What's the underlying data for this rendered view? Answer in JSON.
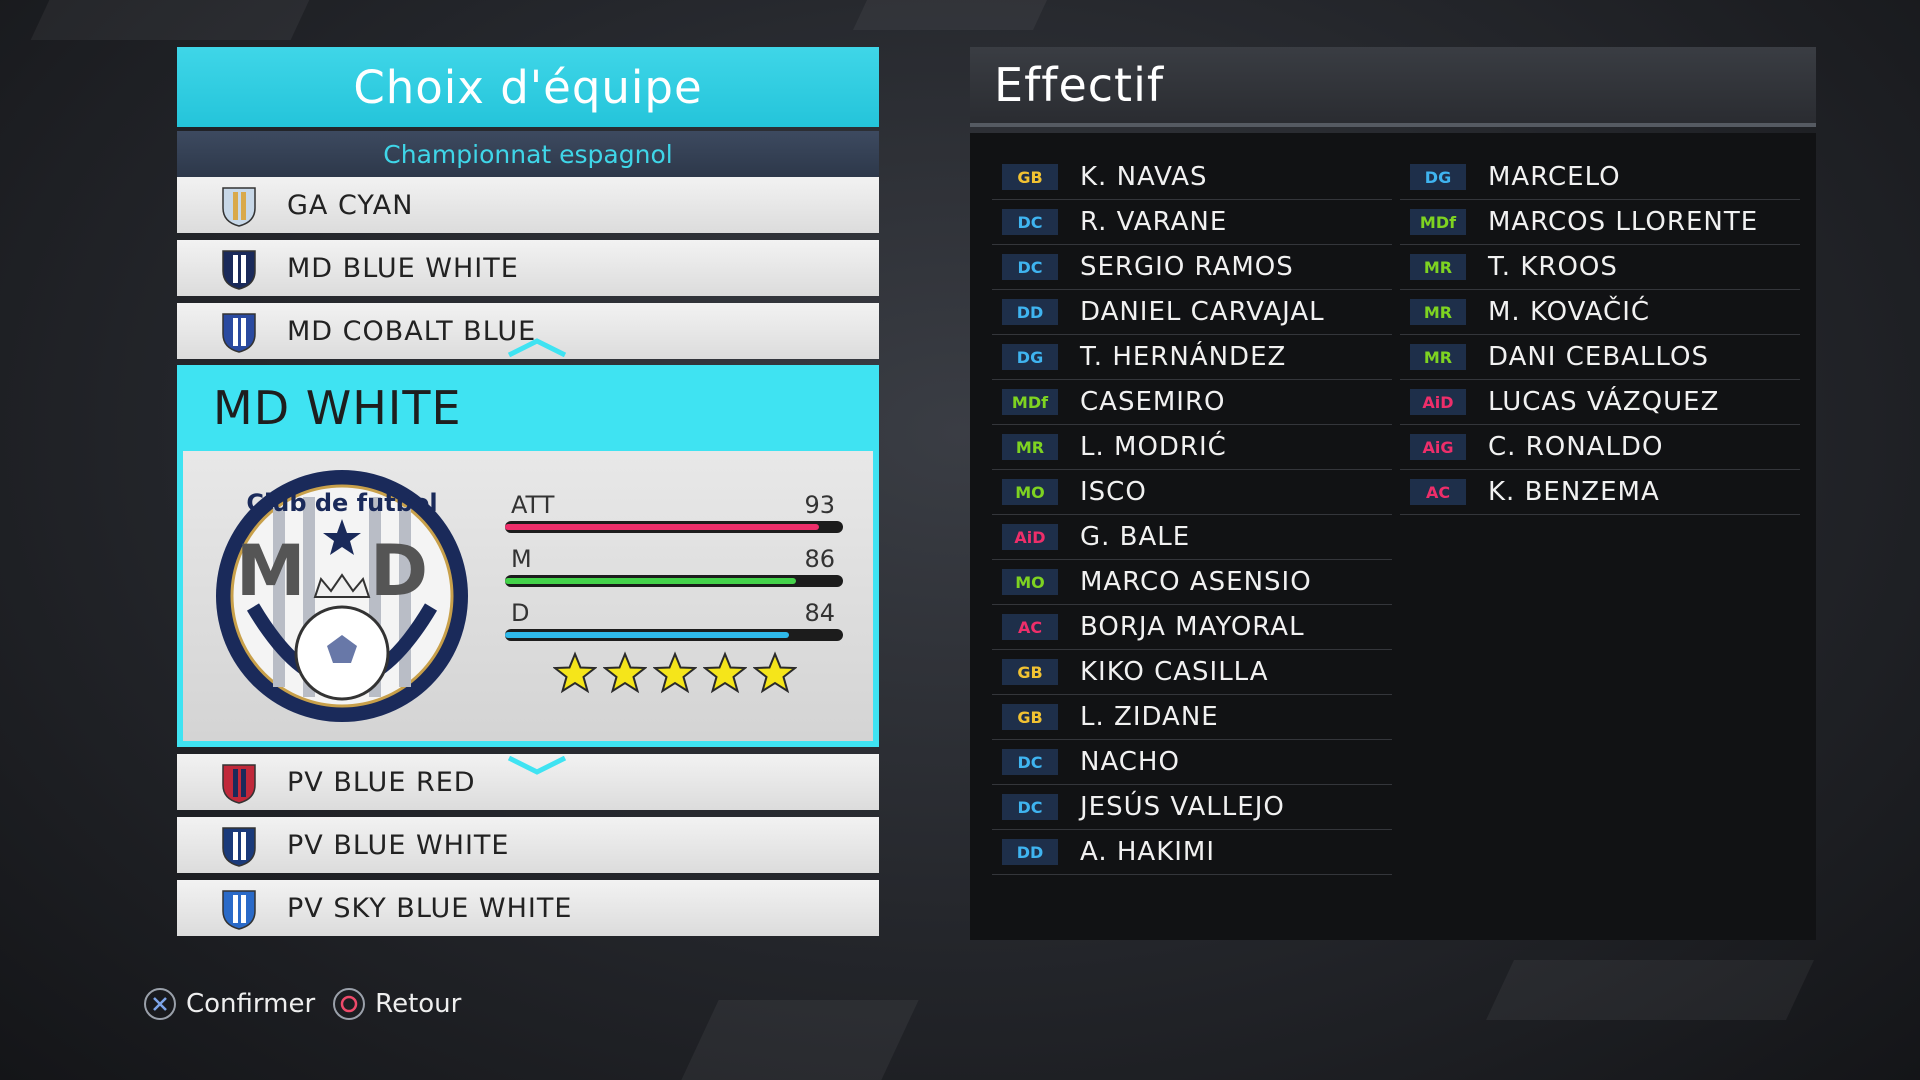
{
  "team_select": {
    "title": "Choix d'équipe",
    "league": "Championnat espagnol",
    "teams_above": [
      {
        "name": "GA CYAN"
      },
      {
        "name": "MD BLUE WHITE"
      },
      {
        "name": "MD COBALT BLUE"
      }
    ],
    "selected": {
      "name": "MD WHITE",
      "emblem_text": "Club de futbol",
      "emblem_letters": "M D",
      "stats": [
        {
          "label": "ATT",
          "value": "93",
          "level": 0.93,
          "color": "#ee2e6a"
        },
        {
          "label": "M",
          "value": "86",
          "level": 0.86,
          "color": "#44d24a"
        },
        {
          "label": "D",
          "value": "84",
          "level": 0.84,
          "color": "#2fb9ea"
        }
      ],
      "stars": 5
    },
    "teams_below": [
      {
        "name": "PV BLUE RED"
      },
      {
        "name": "PV BLUE WHITE"
      },
      {
        "name": "PV SKY BLUE WHITE"
      }
    ]
  },
  "hints": {
    "confirm": "Confirmer",
    "back": "Retour"
  },
  "roster": {
    "title": "Effectif",
    "position_colors": {
      "GB": "#f1c232",
      "DC": "#3fb4f0",
      "DD": "#3fb4f0",
      "DG": "#3fb4f0",
      "MDf": "#7ed321",
      "MR": "#7ed321",
      "MO": "#7ed321",
      "AiD": "#ee2e6a",
      "AiG": "#ee2e6a",
      "AC": "#ee2e6a"
    },
    "col1": [
      {
        "pos": "GB",
        "name": "K. NAVAS"
      },
      {
        "pos": "DC",
        "name": "R. VARANE"
      },
      {
        "pos": "DC",
        "name": "SERGIO RAMOS"
      },
      {
        "pos": "DD",
        "name": "DANIEL CARVAJAL"
      },
      {
        "pos": "DG",
        "name": "T. HERNÁNDEZ"
      },
      {
        "pos": "MDf",
        "name": "CASEMIRO"
      },
      {
        "pos": "MR",
        "name": "L. MODRIĆ"
      },
      {
        "pos": "MO",
        "name": "ISCO"
      },
      {
        "pos": "AiD",
        "name": "G. BALE"
      },
      {
        "pos": "MO",
        "name": "MARCO ASENSIO"
      },
      {
        "pos": "AC",
        "name": "BORJA MAYORAL"
      },
      {
        "pos": "GB",
        "name": "KIKO CASILLA"
      },
      {
        "pos": "GB",
        "name": "L. ZIDANE"
      },
      {
        "pos": "DC",
        "name": "NACHO"
      },
      {
        "pos": "DC",
        "name": "JESÚS VALLEJO"
      },
      {
        "pos": "DD",
        "name": "A. HAKIMI"
      }
    ],
    "col2": [
      {
        "pos": "DG",
        "name": "MARCELO"
      },
      {
        "pos": "MDf",
        "name": "MARCOS LLORENTE"
      },
      {
        "pos": "MR",
        "name": "T. KROOS"
      },
      {
        "pos": "MR",
        "name": "M. KOVAČIĆ"
      },
      {
        "pos": "MR",
        "name": "DANI CEBALLOS"
      },
      {
        "pos": "AiD",
        "name": "LUCAS VÁZQUEZ"
      },
      {
        "pos": "AiG",
        "name": "C. RONALDO"
      },
      {
        "pos": "AC",
        "name": "K. BENZEMA"
      }
    ]
  }
}
